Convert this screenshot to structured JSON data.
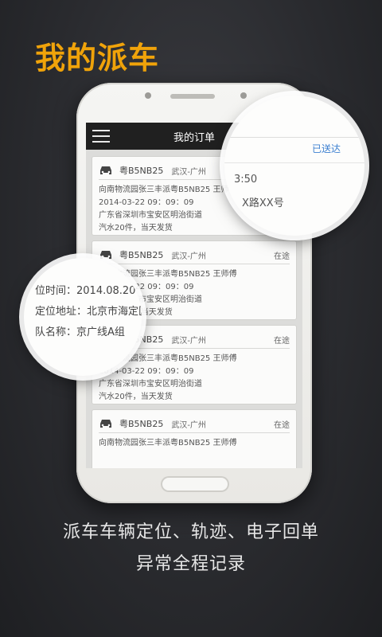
{
  "headline": "我的派车",
  "screen": {
    "title": "我的订单",
    "orders": [
      {
        "plate": "粤B5NB25",
        "route": "武汉-广州",
        "status": "",
        "line1": "向南物流园张三丰派粤B5NB25 王师傅",
        "line2": "2014-03-22 09：09：09",
        "line3": "广东省深圳市宝安区明治街道",
        "line4": "汽水20件，当天发货"
      },
      {
        "plate": "粤B5NB25",
        "route": "武汉-广州",
        "status": "在途",
        "line1": "向南物流园张三丰派粤B5NB25 王师傅",
        "line2": "2014-03-22 09：09：09",
        "line3": "广东省深圳市宝安区明治街道",
        "line4": "汽水20件，当天发货"
      },
      {
        "plate": "粤B5NB25",
        "route": "武汉-广州",
        "status": "在途",
        "line1": "向南物流园张三丰派粤B5NB25 王师傅",
        "line2": "2014-03-22 09：09：09",
        "line3": "广东省深圳市宝安区明治街道",
        "line4": "汽水20件，当天发货"
      },
      {
        "plate": "粤B5NB25",
        "route": "武汉-广州",
        "status": "在途",
        "line1": "向南物流园张三丰派粤B5NB25 王师傅",
        "line2": "",
        "line3": "",
        "line4": ""
      }
    ]
  },
  "zoom_top": {
    "status": "已送达",
    "time": "3:50",
    "address": "X路XX号"
  },
  "zoom_left": {
    "row1": "位时间：2014.08.20",
    "row2": "定位地址：北京市海定区",
    "row3": "队名称：京广线A组"
  },
  "caption": {
    "line1": "派车车辆定位、轨迹、电子回单",
    "line2": "异常全程记录"
  },
  "colors": {
    "accent": "#f0a30a",
    "link": "#3b7fd0",
    "titlebar": "#202020"
  }
}
